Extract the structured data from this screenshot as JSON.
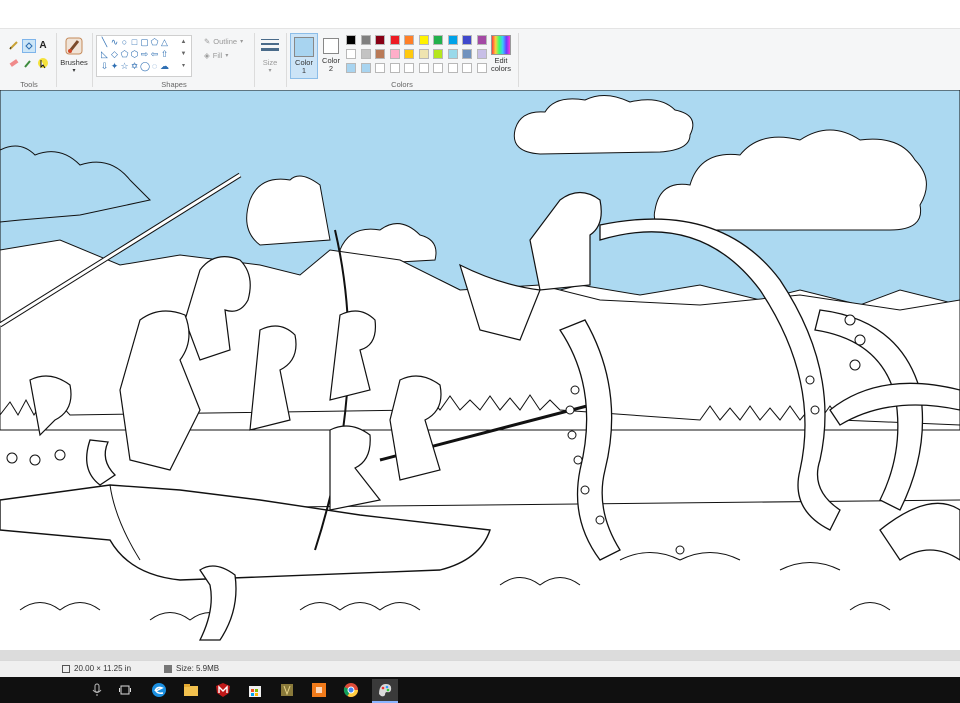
{
  "ribbon": {
    "tools_label": "Tools",
    "brushes_label": "Brushes",
    "shapes_label": "Shapes",
    "outline_label": "Outline",
    "fill_label": "Fill",
    "size_label": "Size",
    "color1_label": "Color 1",
    "color2_label": "Color 2",
    "colors_label": "Colors",
    "edit_colors_label": "Edit colors",
    "color1_value": "#a8d4f0",
    "color2_value": "#ffffff",
    "palette_row1": [
      "#000000",
      "#7f7f7f",
      "#880015",
      "#ed1c24",
      "#ff7f27",
      "#fff200",
      "#22b14c",
      "#00a2e8",
      "#3f48cc",
      "#a349a4"
    ],
    "palette_row2": [
      "#ffffff",
      "#c3c3c3",
      "#b97a57",
      "#ffaec9",
      "#ffc90e",
      "#efe4b0",
      "#b5e61d",
      "#99d9ea",
      "#7092be",
      "#c8bfe7"
    ],
    "palette_row3": [
      "#a8d4f0",
      "#a8d4f0",
      "#ffffff",
      "#ffffff",
      "#ffffff",
      "#ffffff",
      "#ffffff",
      "#ffffff",
      "#ffffff",
      "#ffffff"
    ]
  },
  "canvas": {
    "sky_color": "#acd9f1",
    "line_color": "#111111"
  },
  "status": {
    "dimensions": "20.00 × 11.25 in",
    "size": "Size: 5.9MB"
  },
  "taskbar": {
    "icons": [
      "mic-icon",
      "task-view-icon",
      "edge-icon",
      "file-explorer-icon",
      "mcafee-icon",
      "store-icon",
      "game-icon",
      "orange-app-icon",
      "chrome-icon",
      "paint-icon"
    ]
  }
}
